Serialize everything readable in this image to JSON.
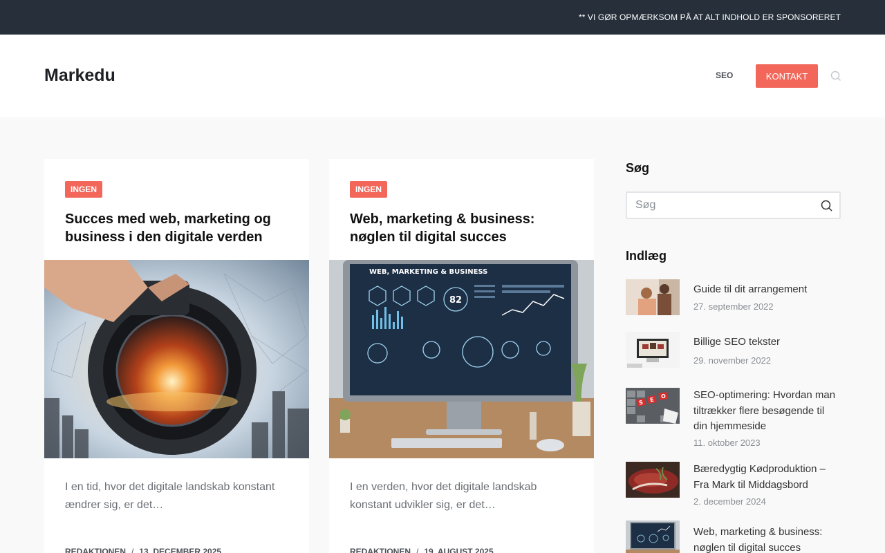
{
  "topbar": {
    "notice": "** VI GØR OPMÆRKSOM PÅ AT ALT INDHOLD ER SPONSORERET"
  },
  "header": {
    "logo": "Markedu",
    "nav": {
      "seo": "SEO",
      "contact": "KONTAKT"
    },
    "search_icon": "search-icon"
  },
  "cards": [
    {
      "category": "INGEN",
      "title": "Succes med web, marketing og business i den digitale verden",
      "excerpt": "I en tid, hvor det digitale landskab konstant ændrer sig, er det…",
      "author": "REDAKTIONEN",
      "separator": "/",
      "date": "13. DECEMBER 2025"
    },
    {
      "category": "INGEN",
      "title": "Web, marketing & business: nøglen til digital succes",
      "excerpt": "I en verden, hvor det digitale landskab konstant udvikler sig, er det…",
      "author": "REDAKTIONEN",
      "separator": "/",
      "date": "19. AUGUST 2025",
      "image_text": "WEB, MARKETING & BUSINESS",
      "gauge_value": "82"
    }
  ],
  "sidebar": {
    "search_heading": "Søg",
    "search_placeholder": "Søg",
    "posts_heading": "Indlæg",
    "posts": [
      {
        "title": "Guide til dit arrangement",
        "date": "27. september 2022"
      },
      {
        "title": "Billige SEO tekster",
        "date": "29. november 2022"
      },
      {
        "title": "SEO-optimering: Hvordan man tiltrækker flere besøgende til din hjemmeside",
        "date": "11. oktober 2023"
      },
      {
        "title": "Bæredygtig Kødproduktion – Fra Mark til Middagsbord",
        "date": "2. december 2024"
      },
      {
        "title": "Web, marketing & business: nøglen til digital succes",
        "date": ""
      }
    ]
  },
  "colors": {
    "accent": "#f2675a",
    "topbar": "#262f3a"
  }
}
